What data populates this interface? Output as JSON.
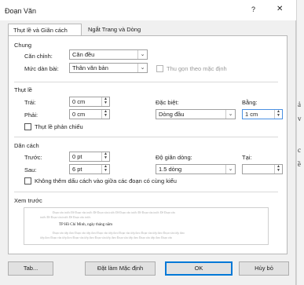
{
  "window": {
    "title": "Đoạn Văn",
    "help": "?",
    "close": "✕"
  },
  "tabs": [
    {
      "label": "Thụt lề và Giãn cách"
    },
    {
      "label": "Ngắt Trang và Dòng"
    }
  ],
  "general": {
    "heading": "Chung",
    "alignment_label": "Căn chỉnh:",
    "alignment_value": "Căn đều",
    "outline_label": "Mức dàn bài:",
    "outline_value": "Thân văn bản",
    "collapse_label": "Thu gọn theo mặc định"
  },
  "indent": {
    "heading": "Thụt lề",
    "left_label": "Trái:",
    "left_value": "0 cm",
    "right_label": "Phải:",
    "right_value": "0 cm",
    "special_label": "Đặc biệt:",
    "special_value": "Dòng đầu",
    "by_label": "Bằng:",
    "by_value": "1 cm",
    "mirror_label": "Thụt lề phản chiếu"
  },
  "spacing": {
    "heading": "Dãn cách",
    "before_label": "Trước:",
    "before_value": "0 pt",
    "after_label": "Sau:",
    "after_value": "6 pt",
    "line_label": "Độ giãn dòng:",
    "line_value": "1.5 dòng",
    "at_label": "Tại:",
    "at_value": "",
    "no_space_label": "Không thêm dấu cách vào giữa các đoạn có cùng kiểu"
  },
  "preview": {
    "heading": "Xem trước",
    "prev_1": "Đoạn văn trước Đề Đoạn văn trước Đề Đoạn văn trước Đề Đoạn văn trước Đề Đoạn văn trước Đề Đoạn văn",
    "prev_2": "trước Đề Đoạn văn trước Đề Đoạn văn trước",
    "current": "TP Hồ Chí Minh, ngày      tháng      năm",
    "next_1": "Đoạn văn tiếp theo Đoạn văn tiếp theo Đoạn văn tiếp theo Đoạn văn tiếp theo Đoạn văn tiếp theo Đoạn văn tiếp theo",
    "next_2": "tiếp theo Đoạn văn tiếp theo Đoạn văn tiếp theo Đoạn văn tiếp theo Đoạn văn tiếp theo Đoạn văn tiếp theo Đoạn văn"
  },
  "buttons": {
    "tabs": "Tab...",
    "set_default": "Đặt làm Mặc định",
    "ok": "OK",
    "cancel": "Hủy bỏ"
  },
  "document_edge": [
    "ả",
    "v",
    "c",
    "ề"
  ]
}
